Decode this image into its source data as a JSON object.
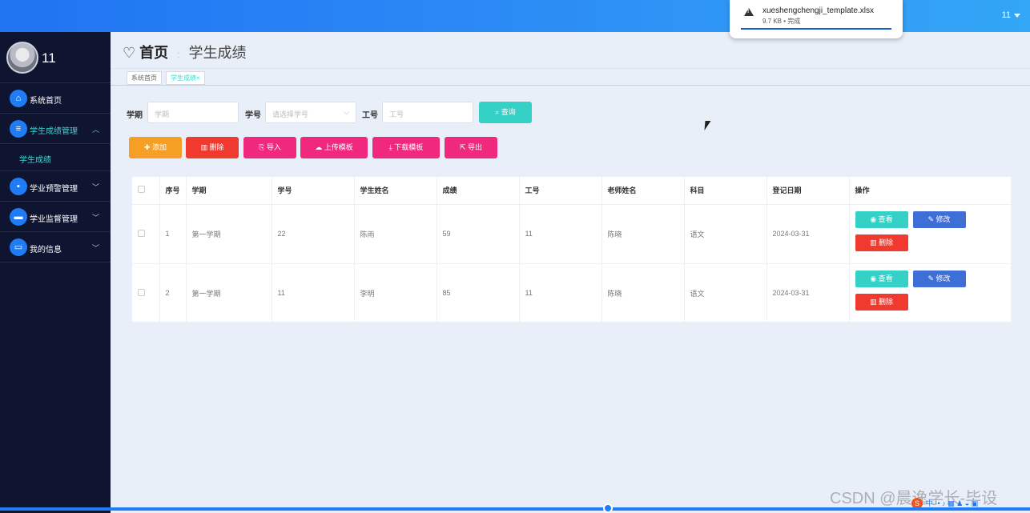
{
  "topbar": {
    "user": "11"
  },
  "download": {
    "filename": "xueshengchengji_template.xlsx",
    "meta": "9.7 KB • 完成"
  },
  "sidebar": {
    "username": "11",
    "items": [
      {
        "label": "系统首页",
        "icon": "home-icon"
      },
      {
        "label": "学生成绩管理",
        "icon": "list-icon",
        "sub": [
          "学生成绩"
        ]
      },
      {
        "label": "学业预警管理",
        "icon": "chat-icon"
      },
      {
        "label": "学业监督管理",
        "icon": "briefcase-icon"
      },
      {
        "label": "我的信息",
        "icon": "card-icon"
      }
    ]
  },
  "breadcrumb": {
    "home": "首页",
    "current": "学生成绩"
  },
  "tags": [
    "系统首页",
    "学生成绩"
  ],
  "search": {
    "term_label": "学期",
    "term_placeholder": "学期",
    "sid_label": "学号",
    "sid_placeholder": "请选择学号",
    "tid_label": "工号",
    "tid_placeholder": "工号",
    "query_button": "查询"
  },
  "toolbar": {
    "add": "添加",
    "delete": "删除",
    "import": "导入",
    "upload_template": "上传模板",
    "download_template": "下载模板",
    "export": "导出"
  },
  "table": {
    "headers": [
      "序号",
      "学期",
      "学号",
      "学生姓名",
      "成绩",
      "工号",
      "老师姓名",
      "科目",
      "登记日期",
      "操作"
    ],
    "rows": [
      [
        "1",
        "第一学期",
        "22",
        "陈雨",
        "59",
        "11",
        "陈晓",
        "语文",
        "2024-03-31"
      ],
      [
        "2",
        "第一学期",
        "11",
        "李明",
        "85",
        "11",
        "陈晓",
        "语文",
        "2024-03-31"
      ]
    ],
    "actions": {
      "view": "查看",
      "edit": "修改",
      "delete": "删除"
    }
  },
  "watermark": "CSDN @晨逸学长-毕设",
  "colors": {
    "accent": "#1f74f2",
    "teal": "#35d0c6",
    "danger": "#f03a2f",
    "pink": "#f0287e",
    "orange": "#f5a024"
  }
}
